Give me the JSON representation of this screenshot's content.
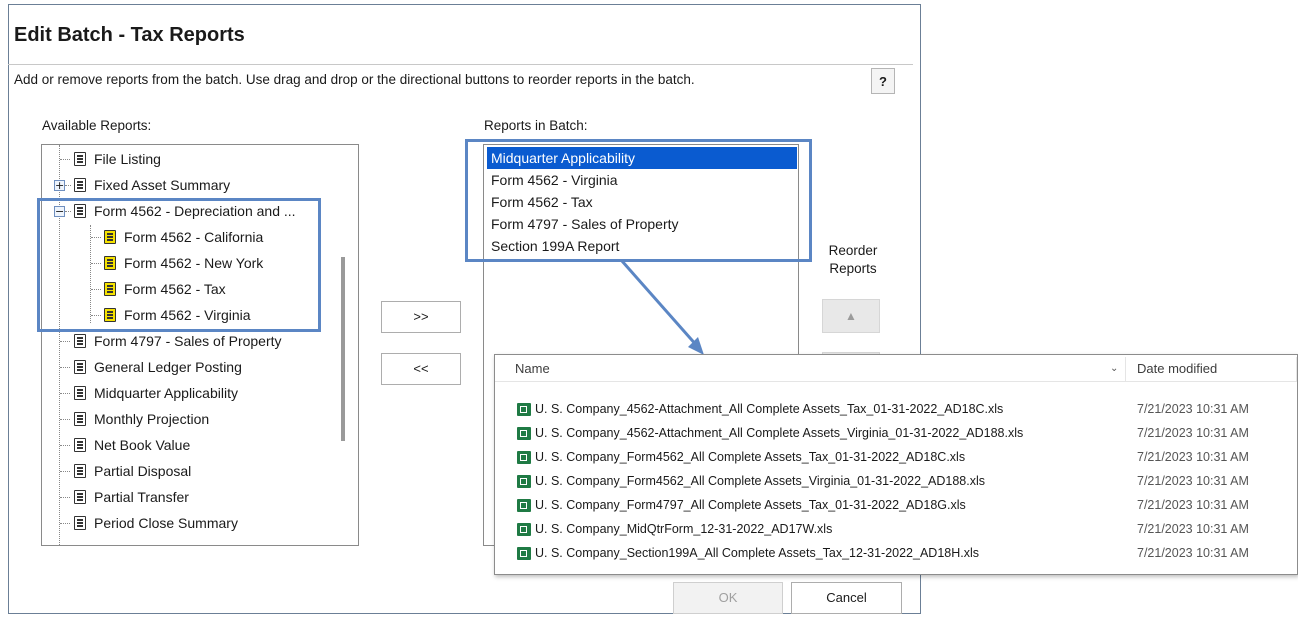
{
  "dialog": {
    "title": "Edit Batch - Tax Reports",
    "instructions": "Add or remove reports from the batch. Use drag and drop or the directional buttons to reorder reports in the batch.",
    "help_label": "?"
  },
  "available": {
    "label": "Available Reports:",
    "items": [
      {
        "label": "File Listing"
      },
      {
        "label": "Fixed Asset Summary",
        "expander": "+"
      },
      {
        "label": "Form 4562 - Depreciation and ...",
        "expander": "−"
      },
      {
        "label": "Form 4562 - California"
      },
      {
        "label": "Form 4562 - New York"
      },
      {
        "label": "Form 4562 - Tax"
      },
      {
        "label": "Form 4562 - Virginia"
      },
      {
        "label": "Form 4797 - Sales of Property"
      },
      {
        "label": "General Ledger Posting"
      },
      {
        "label": "Midquarter Applicability"
      },
      {
        "label": "Monthly Projection"
      },
      {
        "label": "Net Book Value"
      },
      {
        "label": "Partial Disposal"
      },
      {
        "label": "Partial Transfer"
      },
      {
        "label": "Period Close Summary"
      }
    ]
  },
  "buttons": {
    "add": ">>",
    "remove": "<<",
    "move_up": "▲",
    "ok": "OK",
    "cancel": "Cancel"
  },
  "batch": {
    "label": "Reports in Batch:",
    "items": [
      {
        "label": "Midquarter Applicability"
      },
      {
        "label": "Form 4562 - Virginia"
      },
      {
        "label": "Form 4562 - Tax"
      },
      {
        "label": "Form 4797 - Sales of Property"
      },
      {
        "label": "Section 199A Report"
      }
    ]
  },
  "reorder": {
    "label_line1": "Reorder",
    "label_line2": "Reports"
  },
  "explorer": {
    "columns": {
      "name": "Name",
      "date": "Date modified"
    },
    "files": [
      {
        "name": "U. S. Company_4562-Attachment_All Complete Assets_Tax_01-31-2022_AD18C.xls",
        "date": "7/21/2023 10:31 AM"
      },
      {
        "name": "U. S. Company_4562-Attachment_All Complete Assets_Virginia_01-31-2022_AD188.xls",
        "date": "7/21/2023 10:31 AM"
      },
      {
        "name": "U. S. Company_Form4562_All Complete Assets_Tax_01-31-2022_AD18C.xls",
        "date": "7/21/2023 10:31 AM"
      },
      {
        "name": "U. S. Company_Form4562_All Complete Assets_Virginia_01-31-2022_AD188.xls",
        "date": "7/21/2023 10:31 AM"
      },
      {
        "name": "U. S. Company_Form4797_All Complete Assets_Tax_01-31-2022_AD18G.xls",
        "date": "7/21/2023 10:31 AM"
      },
      {
        "name": "U. S. Company_MidQtrForm_12-31-2022_AD17W.xls",
        "date": "7/21/2023 10:31 AM"
      },
      {
        "name": "U. S. Company_Section199A_All Complete Assets_Tax_12-31-2022_AD18H.xls",
        "date": "7/21/2023 10:31 AM"
      }
    ]
  },
  "colors": {
    "highlight": "#5b86c4",
    "selection": "#0a5bd0",
    "excel_green": "#1f7a44",
    "doc_yellow": "#f5e200"
  }
}
